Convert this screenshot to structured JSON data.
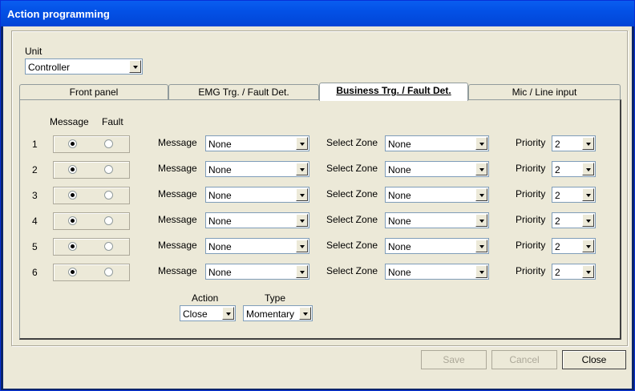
{
  "window": {
    "title": "Action programming"
  },
  "unit": {
    "label": "Unit",
    "value": "Controller"
  },
  "tabs": [
    {
      "label": "Front panel"
    },
    {
      "label": "EMG Trg. / Fault Det."
    },
    {
      "label": "Business Trg. / Fault Det."
    },
    {
      "label": "Mic / Line input"
    }
  ],
  "active_tab": "Business Trg. / Fault Det.",
  "column_headers": {
    "message": "Message",
    "fault": "Fault"
  },
  "row_labels": {
    "message": "Message",
    "zone": "Select Zone",
    "priority": "Priority"
  },
  "rows": [
    {
      "number": "1",
      "selected": "Message",
      "message": "None",
      "zone": "None",
      "priority": "2"
    },
    {
      "number": "2",
      "selected": "Message",
      "message": "None",
      "zone": "None",
      "priority": "2"
    },
    {
      "number": "3",
      "selected": "Message",
      "message": "None",
      "zone": "None",
      "priority": "2"
    },
    {
      "number": "4",
      "selected": "Message",
      "message": "None",
      "zone": "None",
      "priority": "2"
    },
    {
      "number": "5",
      "selected": "Message",
      "message": "None",
      "zone": "None",
      "priority": "2"
    },
    {
      "number": "6",
      "selected": "Message",
      "message": "None",
      "zone": "None",
      "priority": "2"
    }
  ],
  "action": {
    "label": "Action",
    "value": "Close"
  },
  "type": {
    "label": "Type",
    "value": "Momentary"
  },
  "buttons": {
    "save": "Save",
    "cancel": "Cancel",
    "close": "Close"
  }
}
